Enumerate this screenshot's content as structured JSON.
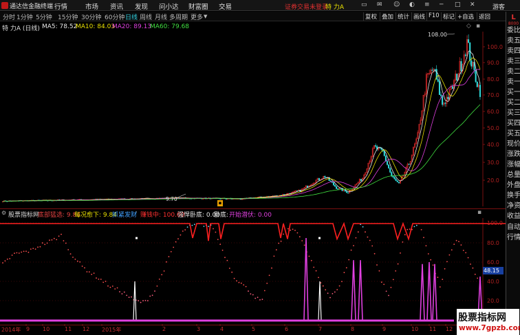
{
  "app": {
    "title": "通达信金融终端",
    "login_status": "证券交易未登录",
    "stock_display": "特 力A",
    "guest": "游客"
  },
  "menu": [
    "行情",
    "市场",
    "资讯",
    "发现",
    "问小达",
    "财富圈",
    "交易"
  ],
  "periods": [
    "分时",
    "1分钟",
    "5分钟",
    "15分钟",
    "30分钟",
    "60分钟",
    "日线",
    "周线",
    "月线",
    "多周期",
    "更多"
  ],
  "active_period": "日线",
  "tools": [
    "复权",
    "叠加",
    "统计",
    "画线",
    "F10",
    "标记",
    "+自选",
    "返回"
  ],
  "main": {
    "title": "特 力A (日线)",
    "ma": [
      {
        "label": "MA5: 78.52",
        "color": "#e8e8e8"
      },
      {
        "label": "MA10: 84.03",
        "color": "#e8e000"
      },
      {
        "label": "MA20: 89.13",
        "color": "#e040e0"
      },
      {
        "label": "MA60: 79.68",
        "color": "#40e040"
      }
    ],
    "high_label": "108.00",
    "low_label": "9.70",
    "y_labels": [
      "100.0",
      "90.0",
      "80.0",
      "70.0",
      "60.0",
      "50.0",
      "40.0",
      "30.0",
      "20.0"
    ]
  },
  "indicator": {
    "name": "股票指标网",
    "items": [
      {
        "label": "底部猛选: 9.84",
        "color": "#e04040"
      },
      {
        "label": "每况愈下: 9.84",
        "color": "#e8e000"
      },
      {
        "label": "抓紧发财",
        "color": "#40a0ff"
      },
      {
        "label": "赚钱中: 100.00",
        "color": "#ff3030"
      },
      {
        "label": "强悍卧底: 0.00",
        "color": "#e8e8e8"
      },
      {
        "label": "卧底:",
        "color": "#e8e8e8"
      },
      {
        "label": "开始潜伏: 0.00",
        "color": "#e040e0"
      }
    ],
    "y_labels": [
      "100.0",
      "80.0",
      "60.0",
      "40.0",
      "20.0"
    ],
    "current_value": "48.15"
  },
  "sidebar_top": [
    "L",
    "8000"
  ],
  "sidebar": [
    "委比",
    "卖五",
    "卖四",
    "卖三",
    "卖二",
    "卖一",
    "买一",
    "买二",
    "买三",
    "买四",
    "买五",
    "现价",
    "涨跌",
    "涨幅",
    "总量",
    "外盘",
    "换手",
    "净资",
    "收益",
    "自动",
    "行情"
  ],
  "dates": [
    "2014年",
    "9",
    "10",
    "11",
    "12",
    "2015年",
    "2",
    "3",
    "4",
    "5",
    "6",
    "7",
    "8",
    "9",
    "10",
    "11",
    "12"
  ],
  "watermark": {
    "title": "股票指标网",
    "url": "www.7gpzb.com"
  },
  "colors": {
    "up": "#ff3030",
    "down": "#30e0e0",
    "grid": "#7a1010",
    "bg": "#000000"
  }
}
